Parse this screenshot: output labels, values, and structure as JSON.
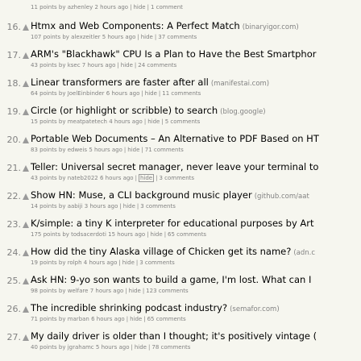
{
  "stories": [
    {
      "rank": "",
      "title": "",
      "site": "",
      "points": "11 points",
      "by": "azhenley",
      "age": "2 hours ago",
      "hide": "hide",
      "comments": "1 comment"
    },
    {
      "rank": "16.",
      "title": "Htmx and Web Components: A Perfect Match",
      "site": "(binaryigor.com)",
      "points": "107 points",
      "by": "alexzeitler",
      "age": "5 hours ago",
      "hide": "hide",
      "comments": "37 comments"
    },
    {
      "rank": "17.",
      "title": "ARM's \"Blackhawk\" CPU Is a Plan to Have the Best Smartphor",
      "site": "",
      "points": "43 points",
      "by": "ksec",
      "age": "7 hours ago",
      "hide": "hide",
      "comments": "24 comments"
    },
    {
      "rank": "18.",
      "title": "Linear transformers are faster after all",
      "site": "(manifestai.com)",
      "points": "64 points",
      "by": "JoelEinbinder",
      "age": "6 hours ago",
      "hide": "hide",
      "comments": "11 comments"
    },
    {
      "rank": "19.",
      "title": "Circle (or highlight or scribble) to search",
      "site": "(blog.google)",
      "points": "15 points",
      "by": "meatpatetech",
      "age": "4 hours ago",
      "hide": "hide",
      "comments": "5 comments"
    },
    {
      "rank": "20.",
      "title": "Portable Web Documents – An Alternative to PDF Based on HT",
      "site": "",
      "points": "83 points",
      "by": "edweis",
      "age": "5 hours ago",
      "hide": "hide",
      "comments": "71 comments"
    },
    {
      "rank": "21.",
      "title": "Teller: Universal secret manager, never leave your terminal to",
      "site": "",
      "points": "43 points",
      "by": "nateb2022",
      "age": "6 hours ago",
      "hide": "hide",
      "comments": "3 comments",
      "hide_highlight": true
    },
    {
      "rank": "22.",
      "title": "Show HN: Muse, a CLI background music player",
      "site": "(github.com/aat",
      "points": "14 points",
      "by": "aabiji",
      "age": "3 hours ago",
      "hide": "hide",
      "comments": "3 comments"
    },
    {
      "rank": "23.",
      "title": "K/simple: a tiny K interpreter for educational purposes by Art",
      "site": "",
      "points": "175 points",
      "by": "todsacerdoti",
      "age": "15 hours ago",
      "hide": "hide",
      "comments": "65 comments"
    },
    {
      "rank": "24.",
      "title": "How did the tiny Alaska village of Chicken get its name?",
      "site": "(adn.c",
      "points": "19 points",
      "by": "rolph",
      "age": "4 hours ago",
      "hide": "hide",
      "comments": "3 comments"
    },
    {
      "rank": "25.",
      "title": "Ask HN: 9-yo son wants to build a game, I'm lost. What can I",
      "site": "",
      "points": "98 points",
      "by": "welfare",
      "age": "7 hours ago",
      "hide": "hide",
      "comments": "123 comments"
    },
    {
      "rank": "26.",
      "title": "The incredible shrinking podcast industry?",
      "site": "(semafor.com)",
      "points": "71 points",
      "by": "marban",
      "age": "6 hours ago",
      "hide": "hide",
      "comments": "65 comments"
    },
    {
      "rank": "27.",
      "title": "My daily driver is older than I thought; it's positively vintage (",
      "site": "",
      "points": "40 points",
      "by": "jgrahamc",
      "age": "5 hours ago",
      "hide": "hide",
      "comments": "78 comments"
    }
  ],
  "labels": {
    "by": "by",
    "sep": "|"
  },
  "colors": {
    "background": "#f6f6ef",
    "muted": "#828282",
    "vote": "#9a9a9a"
  }
}
